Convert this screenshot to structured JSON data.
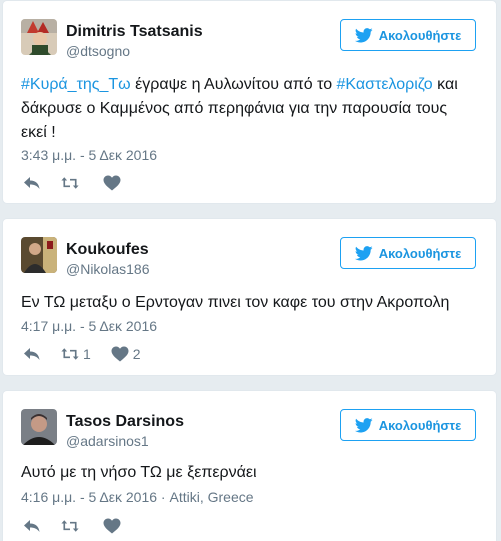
{
  "colors": {
    "link": "#1b95e0",
    "muted": "#657786",
    "border": "#e1e8ed"
  },
  "tweets": [
    {
      "name": "Dimitris Tsatsanis",
      "handle": "@dtsogno",
      "follow_label": "Ακολουθήστε",
      "text": {
        "hashtag1": "#Κυρά_της_Τω",
        "part1": " έγραψε η Αυλωνίτου από το ",
        "hashtag2": "#Καστελοριζο",
        "part2": " και δάκρυσε ο Καμμένος από περηφάνια για την παρουσία τους εκεί !"
      },
      "timestamp": "3:43 μ.μ. - 5 Δεκ 2016",
      "retweets": "",
      "likes": ""
    },
    {
      "name": "Koukoufes",
      "handle": "@Nikolas186",
      "follow_label": "Ακολουθήστε",
      "text": "Εν ΤΩ μεταξυ ο Ερντογαν πινει τον καφε του στην Ακροπολη",
      "timestamp": "4:17 μ.μ. - 5 Δεκ 2016",
      "retweets": "1",
      "likes": "2"
    },
    {
      "name": "Tasos Darsinos",
      "handle": "@adarsinos1",
      "follow_label": "Ακολουθήστε",
      "text": "Αυτό με τη νήσο ΤΩ με ξεπερνάει",
      "timestamp": "4:16 μ.μ. - 5 Δεκ 2016",
      "location": "Attiki, Greece",
      "retweets": "",
      "likes": ""
    }
  ]
}
